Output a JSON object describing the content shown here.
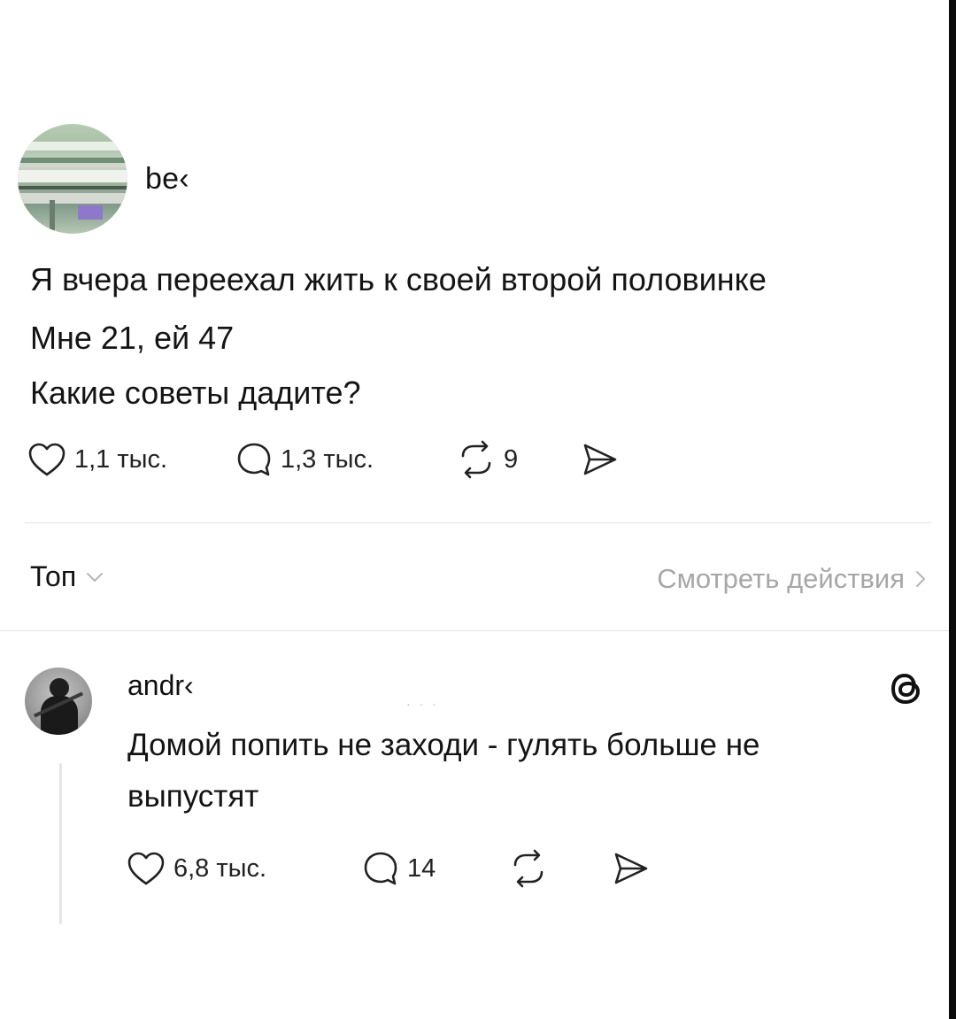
{
  "post": {
    "username": "be‹",
    "lines": [
      "Я вчера переехал жить к своей второй половинке",
      "Мне 21, ей 47",
      "Какие советы дадите?"
    ],
    "actions": {
      "likes": "1,1 тыс.",
      "comments": "1,3 тыс.",
      "reposts": "9",
      "share": ""
    }
  },
  "replies_header": {
    "sort_label": "Топ",
    "view_activity_label": "Смотреть действия"
  },
  "reply": {
    "username": "andr‹",
    "lines": [
      "Домой попить не заходи - гулять больше не",
      "выпустят"
    ],
    "actions": {
      "likes": "6,8 тыс.",
      "comments": "14",
      "reposts": "",
      "share": ""
    }
  },
  "icons": {
    "like": "heart-icon",
    "comment": "speech-bubble-icon",
    "repost": "repost-icon",
    "share": "send-icon",
    "sort": "chevron-down-icon",
    "view": "chevron-right-icon",
    "app": "threads-logo-icon"
  },
  "colors": {
    "text": "#141414",
    "muted": "#a7a7a7",
    "divider": "#e3e3e3"
  }
}
